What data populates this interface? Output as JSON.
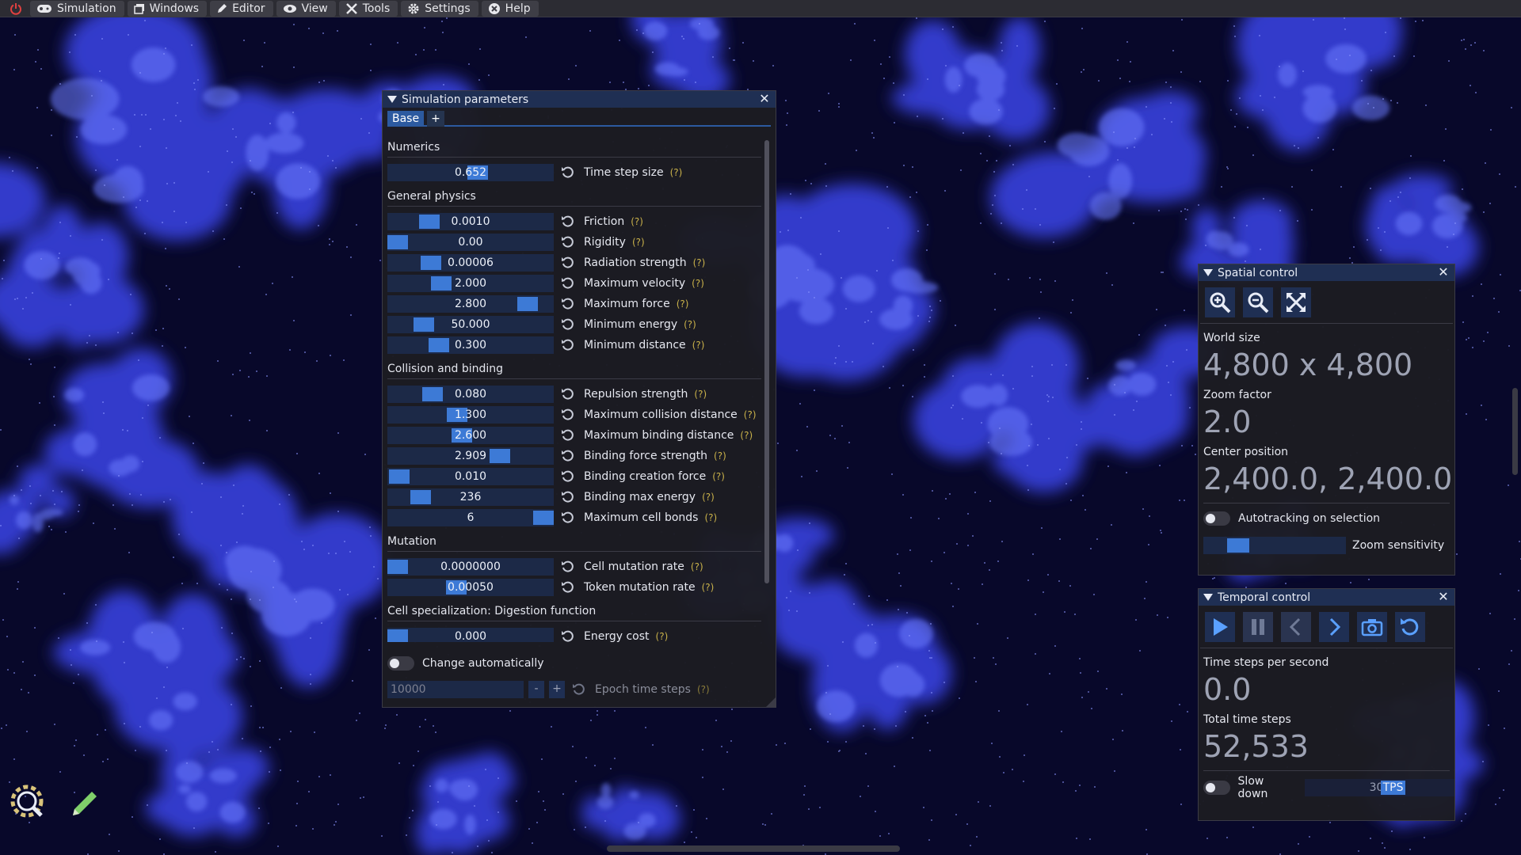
{
  "menubar": {
    "items": [
      {
        "label": "Simulation",
        "icon": "gamepad-icon"
      },
      {
        "label": "Windows",
        "icon": "windows-icon"
      },
      {
        "label": "Editor",
        "icon": "pencil-icon"
      },
      {
        "label": "View",
        "icon": "eye-icon"
      },
      {
        "label": "Tools",
        "icon": "tools-icon"
      },
      {
        "label": "Settings",
        "icon": "gear-icon"
      },
      {
        "label": "Help",
        "icon": "help-icon"
      }
    ]
  },
  "simparams": {
    "title": "Simulation parameters",
    "tabs": [
      "Base",
      "+"
    ],
    "help": "(?)",
    "sections": [
      {
        "title": "Numerics",
        "rows": [
          {
            "value": "0.652",
            "label": "Time step size",
            "grab": 0.55
          }
        ]
      },
      {
        "title": "General physics",
        "rows": [
          {
            "value": "0.0010",
            "label": "Friction",
            "grab": 0.22
          },
          {
            "value": "0.00",
            "label": "Rigidity",
            "grab": 0.0
          },
          {
            "value": "0.00006",
            "label": "Radiation strength",
            "grab": 0.23
          },
          {
            "value": "2.000",
            "label": "Maximum velocity",
            "grab": 0.3
          },
          {
            "value": "2.800",
            "label": "Maximum force",
            "grab": 0.89
          },
          {
            "value": "50.000",
            "label": "Minimum energy",
            "grab": 0.18
          },
          {
            "value": "0.300",
            "label": "Minimum distance",
            "grab": 0.28
          }
        ]
      },
      {
        "title": "Collision and binding",
        "rows": [
          {
            "value": "0.080",
            "label": "Repulsion strength",
            "grab": 0.24
          },
          {
            "value": "1.300",
            "label": "Maximum collision distance",
            "grab": 0.41
          },
          {
            "value": "2.600",
            "label": "Maximum binding distance",
            "grab": 0.44
          },
          {
            "value": "2.909",
            "label": "Binding force strength",
            "grab": 0.7
          },
          {
            "value": "0.010",
            "label": "Binding creation force",
            "grab": 0.01
          },
          {
            "value": "236",
            "label": "Binding max energy",
            "grab": 0.16
          },
          {
            "value": "6",
            "label": "Maximum cell bonds",
            "grab": 1.0
          }
        ]
      },
      {
        "title": "Mutation",
        "rows": [
          {
            "value": "0.0000000",
            "label": "Cell mutation rate",
            "grab": 0.0
          },
          {
            "value": "0.00050",
            "label": "Token mutation rate",
            "grab": 0.4
          }
        ]
      },
      {
        "title": "Cell specialization: Digestion function",
        "rows": [
          {
            "value": "0.000",
            "label": "Energy cost",
            "grab": 0.0
          }
        ]
      }
    ],
    "change_auto_label": "Change automatically",
    "epoch_value": "10000",
    "epoch_minus": "-",
    "epoch_plus": "+",
    "epoch_label": "Epoch time steps"
  },
  "spatial": {
    "title": "Spatial control",
    "world_size_label": "World size",
    "world_size": "4,800 x 4,800",
    "zoom_label": "Zoom factor",
    "zoom": "2.0",
    "center_label": "Center position",
    "center": "2,400.0, 2,400.0",
    "autotrack_label": "Autotracking on selection",
    "zoom_sens_label": "Zoom sensitivity",
    "zoom_sens_level": 0.2
  },
  "temporal": {
    "title": "Temporal control",
    "tps_label": "Time steps per second",
    "tps": "0.0",
    "total_label": "Total time steps",
    "total": "52,533",
    "slowdown_label": "Slow down",
    "slowdown_value": "30",
    "slowdown_unit": "TPS"
  },
  "colors": {
    "accent": "#3d7ad6",
    "title_bar": "#1f2f53",
    "world_cells": "#4a5cff"
  }
}
